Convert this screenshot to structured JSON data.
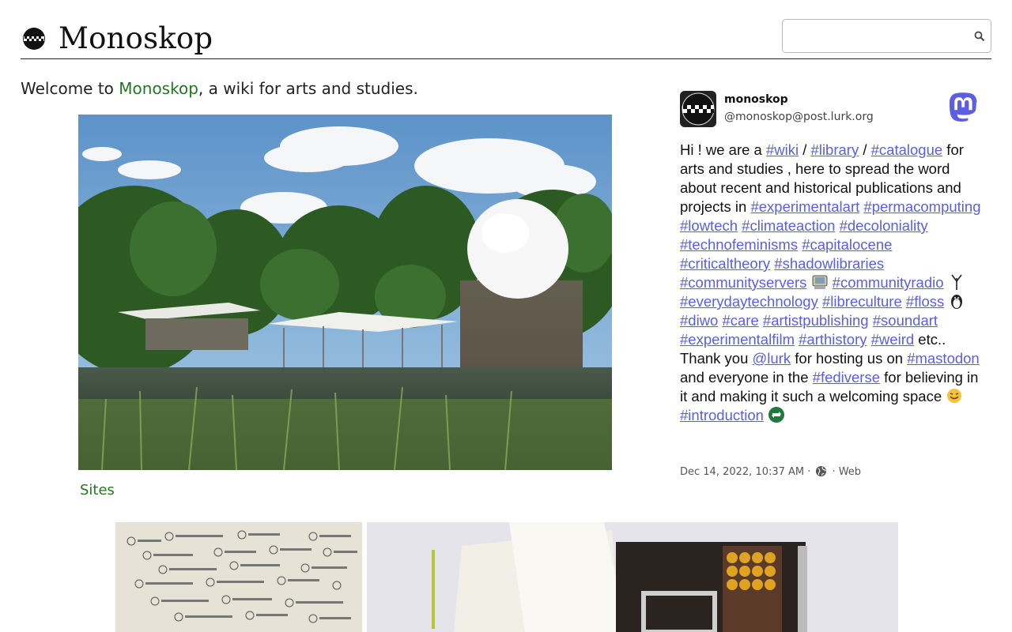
{
  "header": {
    "site_title": "Monoskop",
    "search_placeholder": ""
  },
  "welcome": {
    "before": "Welcome to ",
    "link": "Monoskop",
    "after": ", a wiki for arts and studies."
  },
  "feature": {
    "caption_link": "Sites"
  },
  "post": {
    "display_name": "monoskop",
    "handle": "@monoskop@post.lurk.org",
    "t1": "Hi ! we are a ",
    "tag_wiki": "#wiki",
    "sep1": " / ",
    "tag_library": "#library",
    "sep2": " / ",
    "tag_catalogue": "#catalogue",
    "t2": " for arts and studies , here to spread the word about recent and historical publications and projects in ",
    "tag_experimentalart": "#experimentalart",
    "tag_permacomputing": "#permacomputing",
    "tag_lowtech": "#lowtech",
    "tag_climateaction": "#climateaction",
    "tag_decoloniality": "#decoloniality",
    "tag_technofeminisms": "#technofeminisms",
    "tag_capitalocene": "#capitalocene",
    "tag_criticaltheory": "#criticaltheory",
    "tag_shadowlibraries": "#shadowlibraries",
    "tag_communityservers": "#communityservers",
    "tag_communityradio": "#communityradio",
    "tag_everydaytechnology": "#everydaytechnology",
    "tag_libreculture": "#libreculture",
    "tag_floss": "#floss",
    "tag_diwo": "#diwo",
    "tag_care": "#care",
    "tag_artistpublishing": "#artistpublishing",
    "tag_soundart": "#soundart",
    "tag_experimentalfilm": "#experimentalfilm",
    "tag_arthistory": "#arthistory",
    "tag_weird": "#weird",
    "t3": " etc.. Thank you ",
    "mention_lurk": "@lurk",
    "t4": " for hosting us on ",
    "tag_mastodon": "#mastodon",
    "t5": " and everyone in the ",
    "tag_fediverse": "#fediverse",
    "t6": " for believing in it and making it such a welcoming space ",
    "tag_introduction": "#introduction",
    "timestamp": "Dec 14, 2022, 10:37 AM",
    "dot1": "·",
    "dot2": "·",
    "source": "Web"
  },
  "icons": {
    "search": "magnifier-icon",
    "visibility": "globe-icon",
    "brand": "mastodon-logo-icon"
  },
  "colors": {
    "link_green": "#227722",
    "hashtag": "#5b5ee0",
    "mastodon_brand": "#5b5ee0"
  }
}
